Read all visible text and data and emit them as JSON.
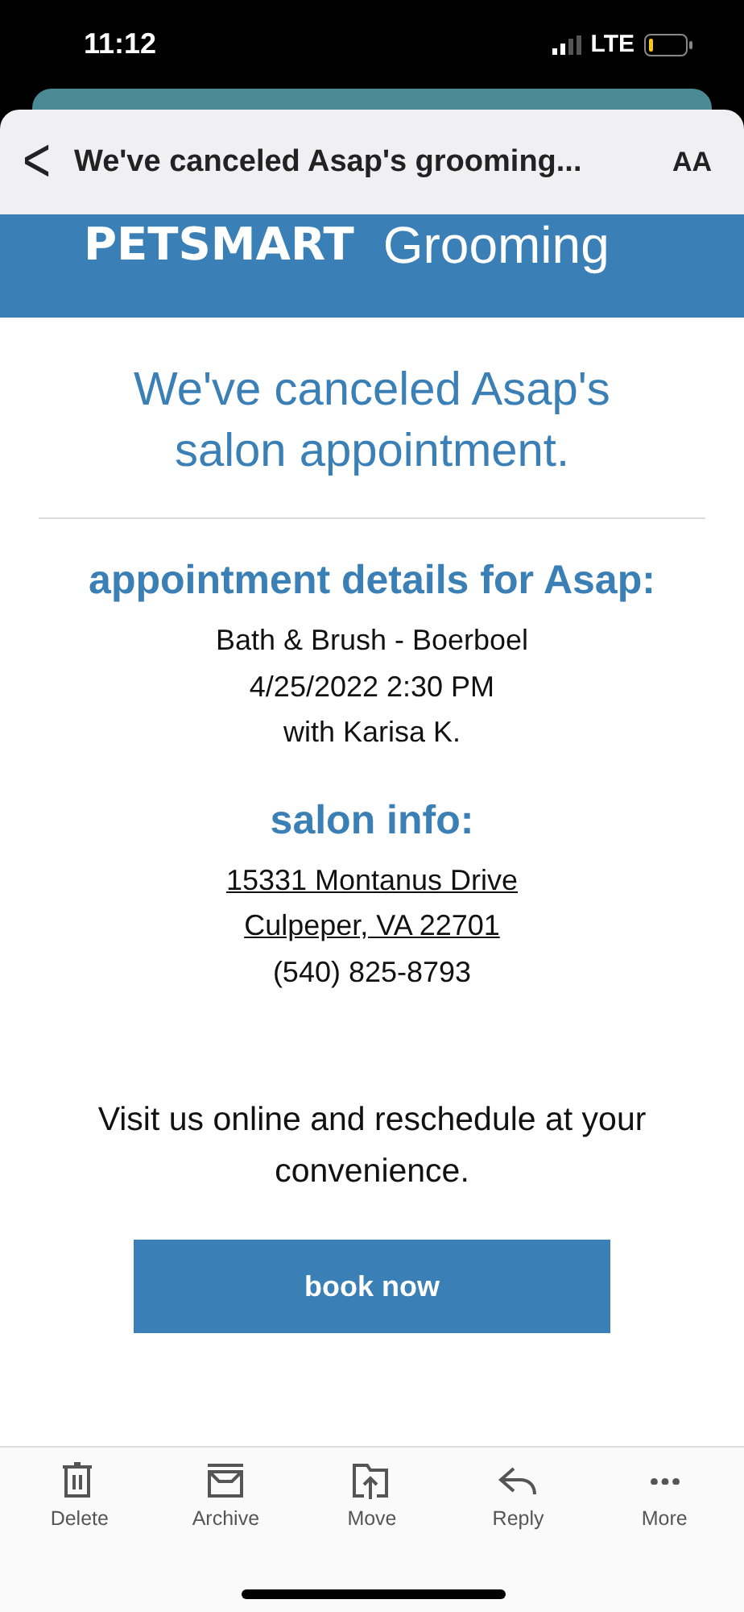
{
  "status_bar": {
    "time": "11:12",
    "network": "LTE"
  },
  "header": {
    "back": "<",
    "title": "We've canceled Asap's grooming...",
    "text_size": "AA"
  },
  "banner": {
    "brand": "PETSMART",
    "service": "Grooming"
  },
  "email": {
    "heading": "We've canceled Asap's salon appointment.",
    "details_title": "appointment details for Asap:",
    "details": [
      "Bath & Brush - Boerboel",
      "4/25/2022 2:30 PM",
      "with Karisa K."
    ],
    "salon_title": "salon info:",
    "salon": [
      {
        "text": "15331 Montanus Drive",
        "kind": "link"
      },
      {
        "text": "Culpeper, VA 22701",
        "kind": "link"
      },
      {
        "text": "(540) 825-8793",
        "kind": "text"
      }
    ],
    "message": "Visit us online and reschedule at your convenience.",
    "button": "book now"
  },
  "toolbar": [
    {
      "label": "Delete",
      "kind": "delete"
    },
    {
      "label": "Archive",
      "kind": "archive"
    },
    {
      "label": "Move",
      "kind": "move"
    },
    {
      "label": "Reply",
      "kind": "reply"
    },
    {
      "label": "More",
      "kind": "more"
    }
  ]
}
